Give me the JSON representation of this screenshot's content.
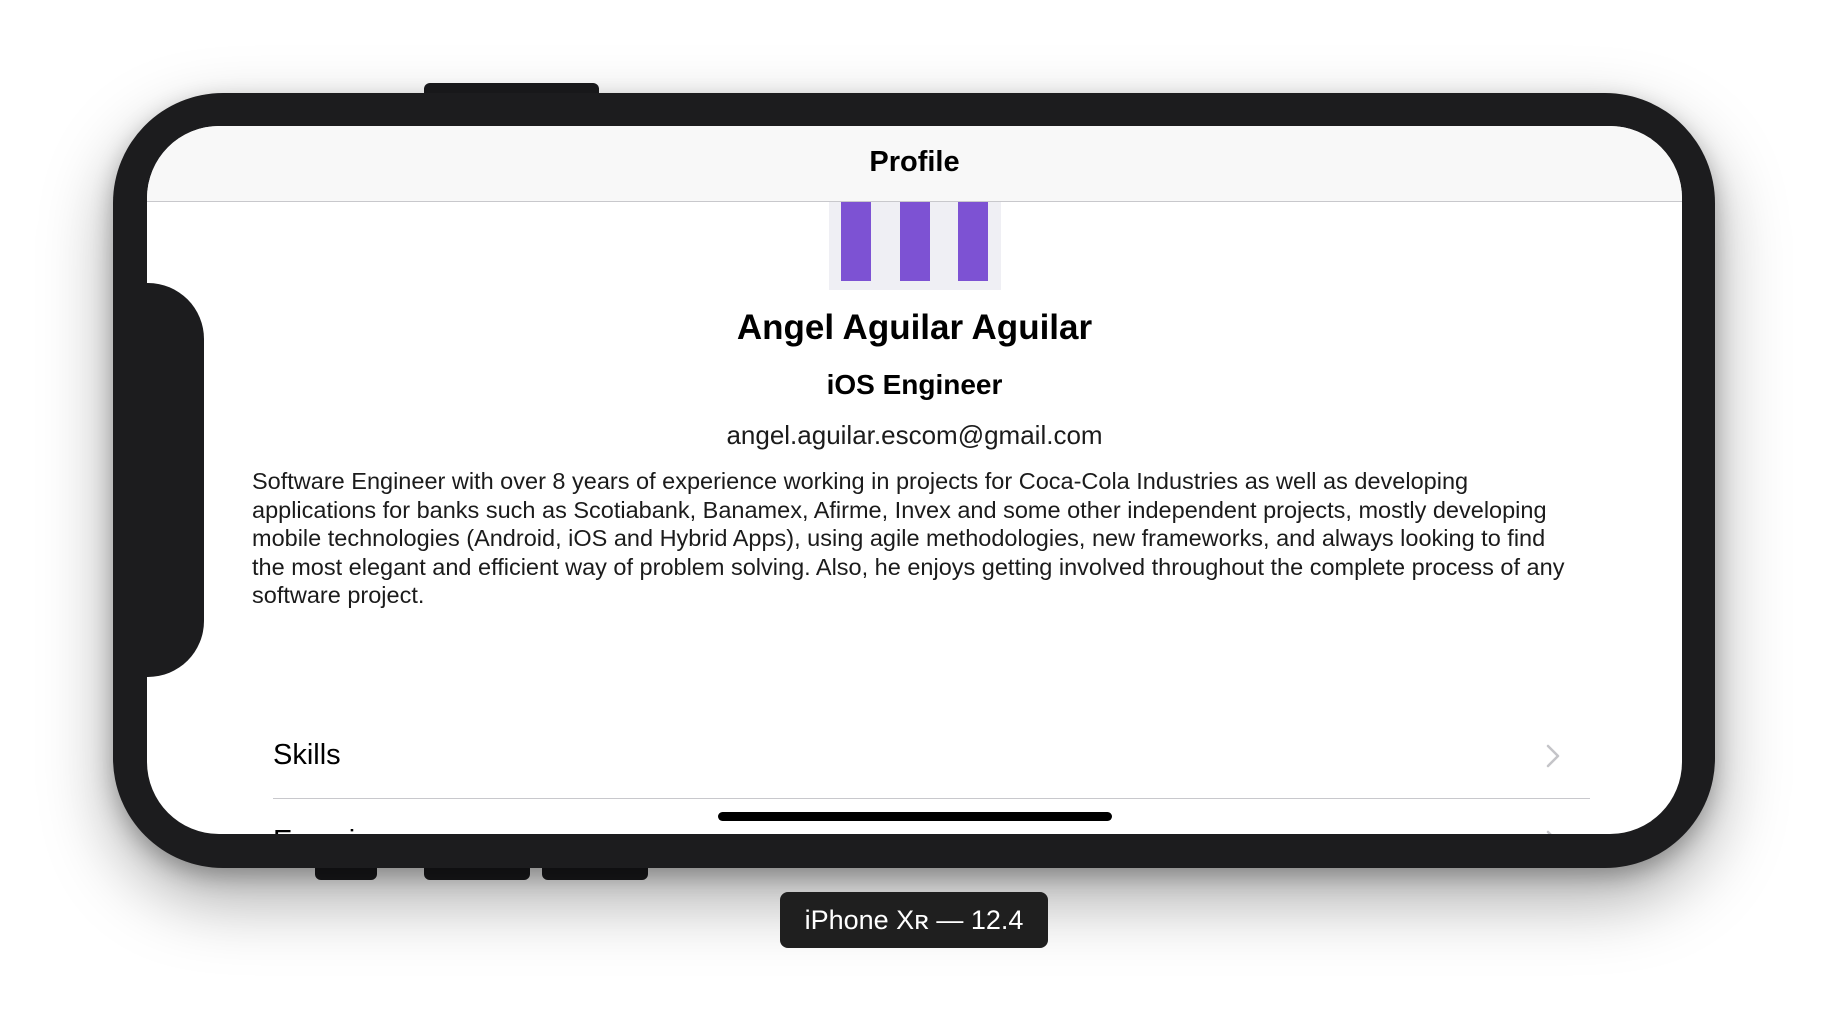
{
  "nav": {
    "title": "Profile"
  },
  "avatar": {
    "bar_color": "#7d52d3",
    "background": "#efeff4"
  },
  "profile": {
    "name": "Angel Aguilar Aguilar",
    "role": "iOS Engineer",
    "email": "angel.aguilar.escom@gmail.com",
    "bio": "Software Engineer with over 8 years of experience working in projects for Coca-Cola Industries as well as developing applications for banks such as Scotiabank, Banamex, Afirme, Invex and some other independent projects, mostly developing mobile technologies (Android, iOS and Hybrid Apps), using agile methodologies, new frameworks, and always looking to find the most elegant and efficient way of problem solving. Also, he enjoys getting involved throughout the complete process of any software project."
  },
  "menu": {
    "items": [
      {
        "label": "Skills",
        "icon": "chevron-right-icon"
      },
      {
        "label": "Experience",
        "icon": "chevron-right-icon"
      }
    ]
  },
  "device": {
    "caption": "iPhone Xʀ — 12.4"
  }
}
